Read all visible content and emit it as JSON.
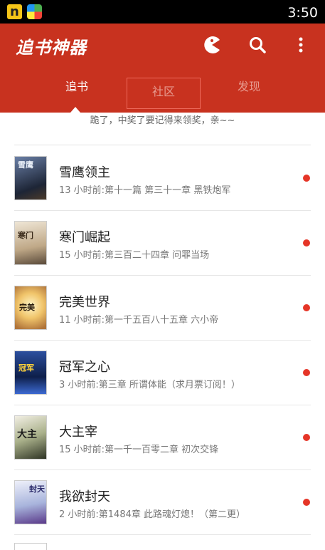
{
  "statusbar": {
    "time": "3:50",
    "icons": [
      "n-app-icon",
      "game-app-icon"
    ],
    "n_label": "n"
  },
  "appbar": {
    "title": "追书神器",
    "color": "#c8321f",
    "actions": [
      "pacman-icon",
      "search-icon",
      "more-vertical-icon"
    ],
    "tabs": [
      {
        "label": "追书",
        "active": true
      },
      {
        "label": "社区",
        "active": false
      },
      {
        "label": "发现",
        "active": false
      }
    ]
  },
  "notice": "跪了，中奖了要记得来领奖，亲~~",
  "books": [
    {
      "title": "雪鹰领主",
      "update": "13 小时前:第十一篇 第三十一章 黑铁炮军",
      "unread": true,
      "cover_color": "#3a4a6a",
      "cover_text": "雪鹰"
    },
    {
      "title": "寒门崛起",
      "update": "15 小时前:第三百二十四章 问罪当场",
      "unread": true,
      "cover_color": "#c9b79a",
      "cover_text": "寒门"
    },
    {
      "title": "完美世界",
      "update": "11 小时前:第一千五百八十五章 六小帝",
      "unread": true,
      "cover_color": "#e8c27a",
      "cover_text": "完美"
    },
    {
      "title": "冠军之心",
      "update": "3 小时前:第三章 所谓体能（求月票订阅！）",
      "unread": true,
      "cover_color": "#1f3f86",
      "cover_text": "冠军"
    },
    {
      "title": "大主宰",
      "update": "15 小时前:第一千一百零二章 初次交锋",
      "unread": true,
      "cover_color": "#8a9a6a",
      "cover_text": "大主"
    },
    {
      "title": "我欲封天",
      "update": "2 小时前:第1484章 此路魂灯熄！（第二更）",
      "unread": true,
      "cover_color": "#b6c0dc",
      "cover_text": "封天"
    }
  ]
}
